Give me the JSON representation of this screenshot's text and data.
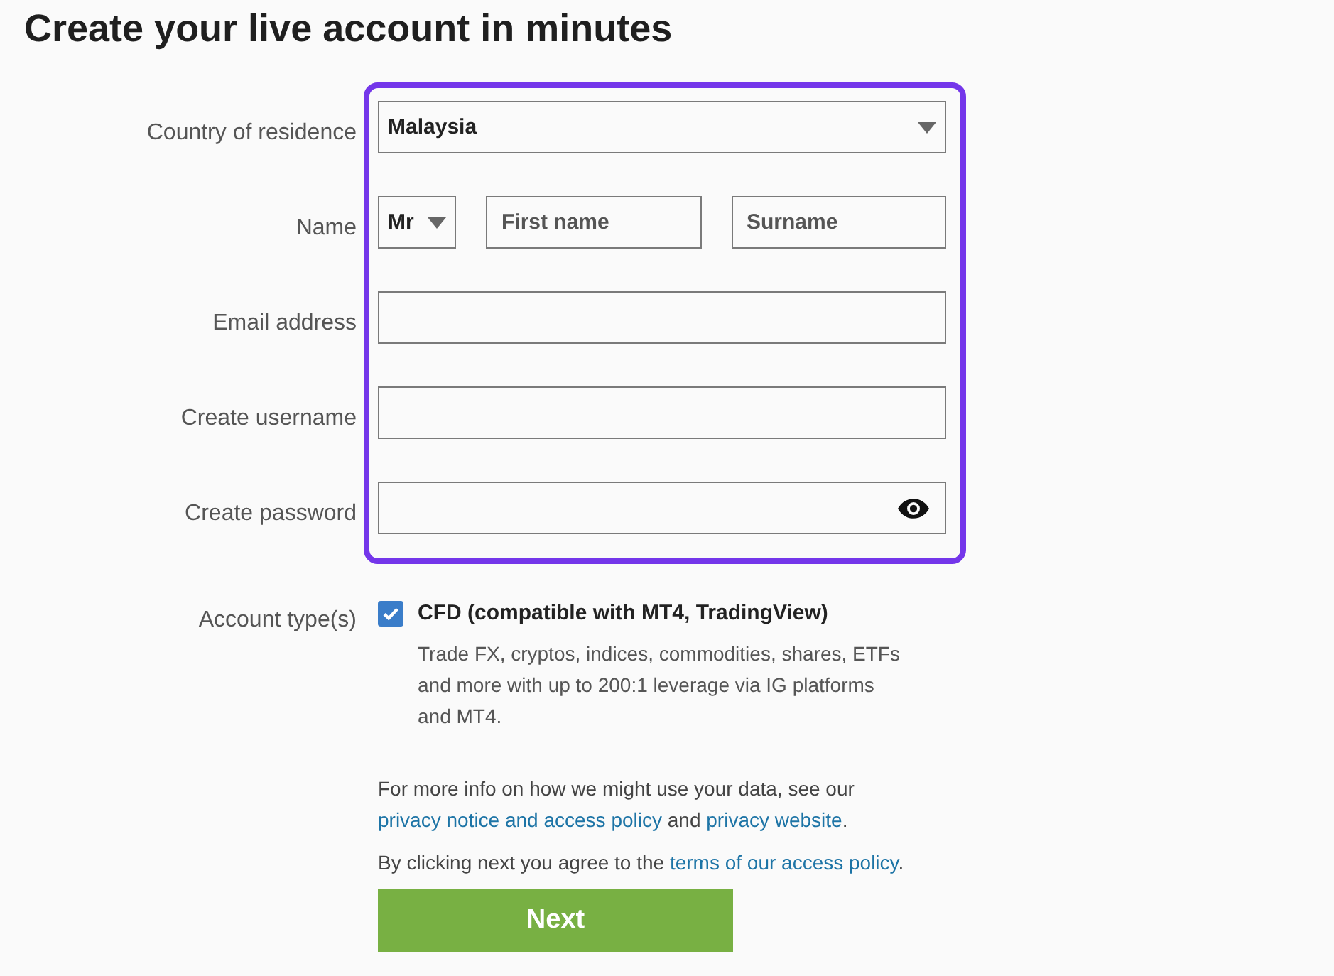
{
  "title": "Create your live account in minutes",
  "form": {
    "highlighted": true,
    "rows": [
      {
        "kind": "select",
        "label": "Country of residence",
        "value": "Malaysia"
      },
      {
        "kind": "name",
        "label": "Name",
        "salutation": "Mr",
        "first_name": {
          "placeholder": "First name"
        },
        "surname": {
          "placeholder": "Surname"
        }
      },
      {
        "kind": "text",
        "label": "Email address"
      },
      {
        "kind": "text",
        "label": "Create username"
      },
      {
        "kind": "password",
        "label": "Create password"
      }
    ]
  },
  "account_types": {
    "label": "Account type(s)",
    "options": [
      {
        "checked": true,
        "title": "CFD (compatible with MT4, TradingView)",
        "description": "Trade FX, cryptos, indices, commodities, shares, ETFs and more with up to 200:1 leverage via IG platforms and MT4."
      }
    ]
  },
  "notices": [
    {
      "parts": [
        {
          "kind": "text",
          "text": "For more info on how we might use your data, see our "
        },
        {
          "kind": "link",
          "text": "privacy notice and access policy"
        },
        {
          "kind": "text",
          "text": " and "
        },
        {
          "kind": "link",
          "text": "privacy website"
        },
        {
          "kind": "text",
          "text": "."
        }
      ]
    },
    {
      "parts": [
        {
          "kind": "text",
          "text": "By clicking next you agree to the "
        },
        {
          "kind": "link",
          "text": "terms of our access policy"
        },
        {
          "kind": "text",
          "text": "."
        }
      ]
    }
  ],
  "next_button": {
    "label": "Next"
  }
}
